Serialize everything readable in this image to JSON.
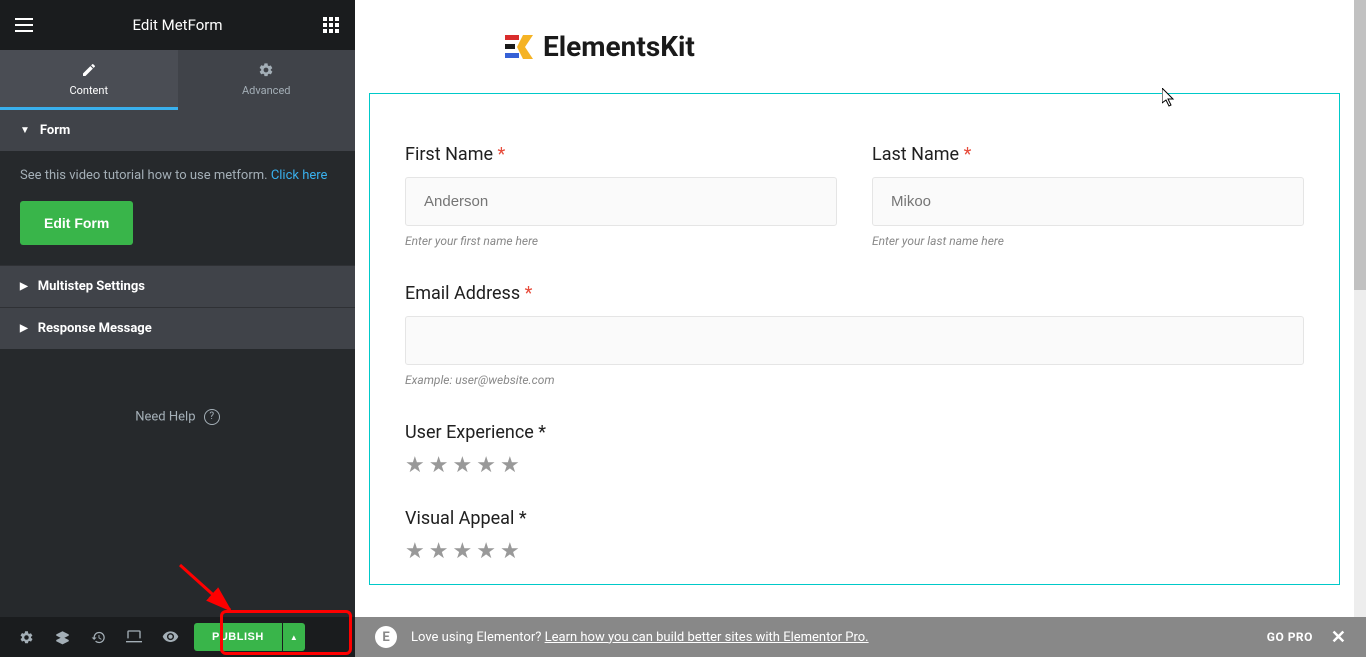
{
  "header": {
    "title": "Edit MetForm"
  },
  "tabs": {
    "content": "Content",
    "advanced": "Advanced"
  },
  "sections": {
    "form": {
      "label": "Form",
      "tutorial_text": "See this video tutorial how to use metform. ",
      "tutorial_link": "Click here",
      "edit_btn": "Edit Form"
    },
    "multistep": "Multistep Settings",
    "response": "Response Message"
  },
  "help": {
    "label": "Need Help"
  },
  "footer": {
    "publish": "PUBLISH"
  },
  "preview": {
    "logo": "ElementsKit",
    "first_name": {
      "label": "First Name ",
      "placeholder": "Anderson",
      "help": "Enter your first name here"
    },
    "last_name": {
      "label": "Last Name ",
      "placeholder": "Mikoo",
      "help": "Enter your last name here"
    },
    "email": {
      "label": "Email Address ",
      "help": "Example: user@website.com"
    },
    "ux": {
      "label": "User Experience *"
    },
    "visual": {
      "label": "Visual Appeal *"
    }
  },
  "bottombar": {
    "text": "Love using Elementor? ",
    "link": "Learn how you can build better sites with Elementor Pro.",
    "go_pro": "GO PRO"
  }
}
